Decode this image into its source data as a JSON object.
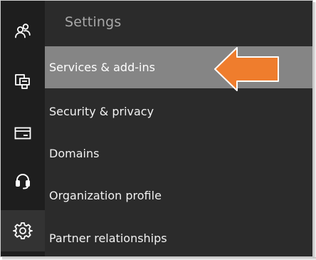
{
  "rail": [
    {
      "name": "users-icon"
    },
    {
      "name": "devices-icon"
    },
    {
      "name": "billing-icon"
    },
    {
      "name": "support-icon"
    },
    {
      "name": "settings-icon"
    }
  ],
  "panel": {
    "title": "Settings",
    "items": [
      {
        "label": "Services & add-ins",
        "selected": true
      },
      {
        "label": "Security & privacy"
      },
      {
        "label": "Domains"
      },
      {
        "label": "Organization profile"
      },
      {
        "label": "Partner relationships"
      }
    ]
  },
  "colors": {
    "rail_bg": "#1e1e1e",
    "panel_bg": "#2b2b2b",
    "selected_bg": "#858585",
    "arrow": "#ef7d2d"
  }
}
